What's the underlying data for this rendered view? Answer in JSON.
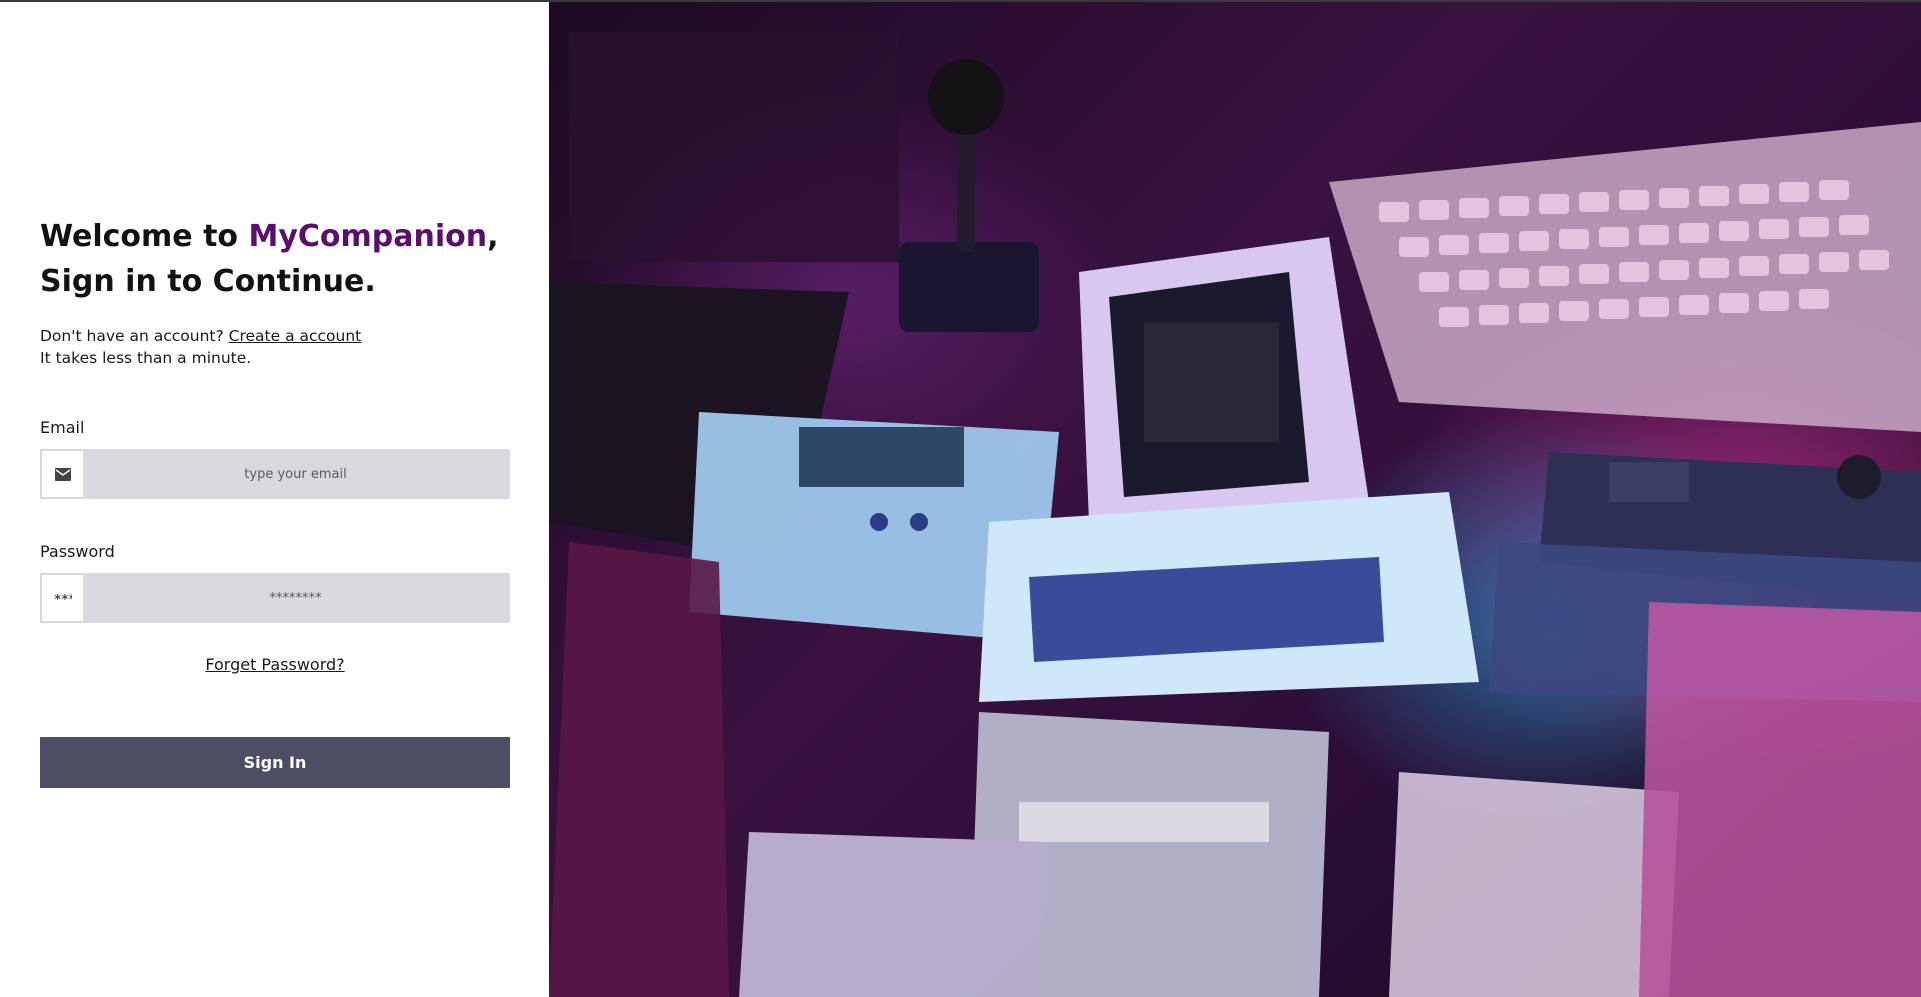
{
  "heading": {
    "welcome_prefix": "Welcome to ",
    "brand": "MyCompanion",
    "welcome_suffix": ",",
    "line2": "Sign in to Continue."
  },
  "signup": {
    "prompt": "Don't have an account?",
    "link_label": "Create a account",
    "note": "It takes less than a minute."
  },
  "email": {
    "label": "Email",
    "placeholder": "type your email",
    "icon": "mail-icon"
  },
  "password": {
    "label": "Password",
    "placeholder": "********",
    "icon": "password-dots-icon"
  },
  "forgot_label": "Forget Password?",
  "signin_label": "Sign In",
  "hero": {
    "image": "retro-computers-photo",
    "colors": {
      "magenta": "#e0409a",
      "cyan": "#2ab4f0",
      "dark": "#1c0a22"
    }
  },
  "colors": {
    "brand": "#5b0e6e",
    "button": "#4c4e63",
    "input_bg": "#d8d8df"
  }
}
